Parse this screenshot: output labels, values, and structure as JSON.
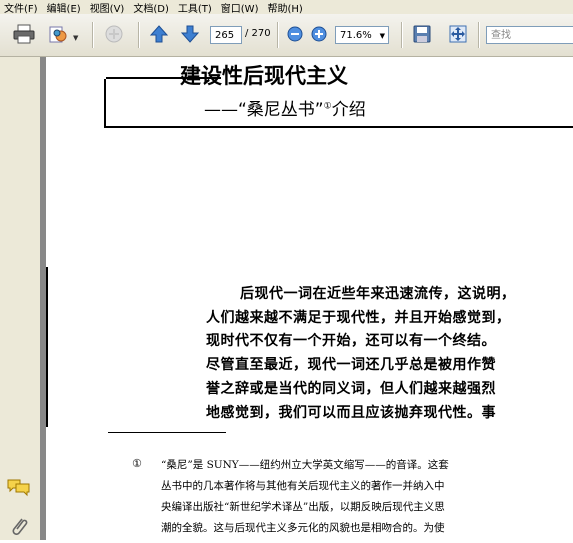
{
  "menu": [
    "文件(F)",
    "编辑(E)",
    "视图(V)",
    "文档(D)",
    "工具(T)",
    "窗口(W)",
    "帮助(H)"
  ],
  "toolbar": {
    "page_current": "265",
    "page_total": "/ 270",
    "zoom_value": "71.6%",
    "search_placeholder": "查找"
  },
  "icons": [
    "print-icon",
    "export-icon",
    "hand-icon",
    "page-up-icon",
    "page-down-icon",
    "zoom-out-icon",
    "zoom-in-icon",
    "save-icon",
    "fit-width-icon",
    "fit-page-icon",
    "comment-icon",
    "attachment-icon"
  ],
  "document": {
    "title": "建设性后现代主义",
    "subtitle": "——“桑尼丛书”",
    "subtitle_sup": "①",
    "subtitle_tail": "介绍",
    "body_lines": [
      "后现代一词在近些年来迅速流传，这说明，",
      "人们越来越不满足于现代性，并且开始感觉到，",
      "现时代不仅有一个开始，还可以有一个终结。",
      "尽管直至最近，现代一词还几乎总是被用作赞",
      "誉之辞或是当代的同义词，但人们越来越强烈",
      "地感觉到，我们可以而且应该抛弃现代性。事"
    ],
    "footnote_marker": "①",
    "footnote_lines": [
      "“桑尼”是 SUNY——纽约州立大学英文缩写——的音译。这套",
      "丛书中的几本著作将与其他有关后现代主义的著作一并纳入中",
      "央编译出版社“新世纪学术译丛”出版，以期反映后现代主义思",
      "潮的全貌。这与后现代主义多元化的风貌也是相吻合的。为使"
    ]
  }
}
